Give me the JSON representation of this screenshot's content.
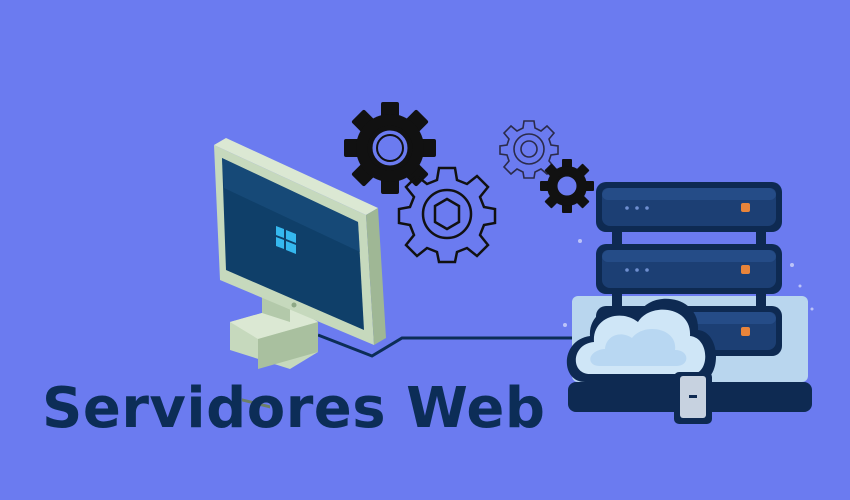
{
  "title": "Servidores Web",
  "colors": {
    "background": "#6b7bf0",
    "title": "#0c2d57",
    "monitor_body": "#c6d9bd",
    "monitor_screen": "#0f3f69",
    "server_rack": "#0e2a52",
    "server_led": "#e8843a",
    "cloud": "#cfe6f7",
    "gear_dark": "#111111"
  },
  "icons": [
    "monitor-icon",
    "windows-logo-icon",
    "gear-icon",
    "server-rack-icon",
    "cloud-icon"
  ]
}
